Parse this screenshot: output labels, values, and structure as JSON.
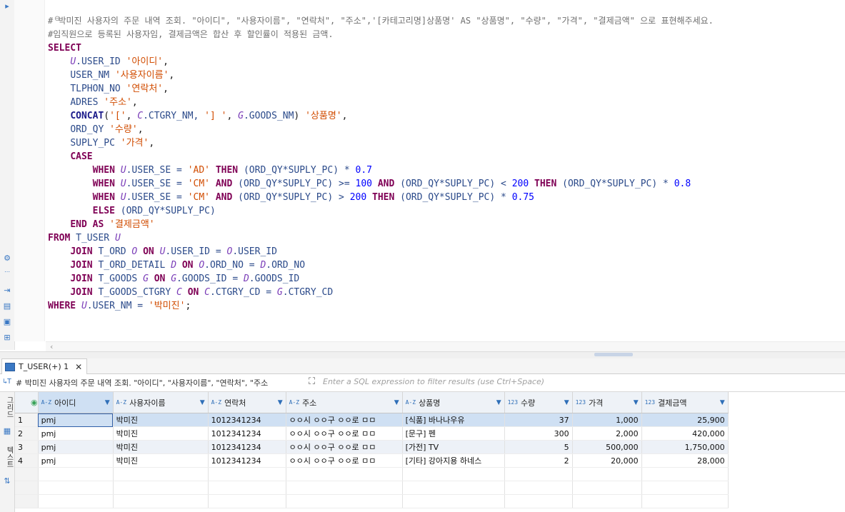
{
  "editor": {
    "lines": [
      [
        {
          "t": "# 박미진 사용자의 주문 내역 조회. \"아이디\", \"사용자이름\", \"연락처\", \"주소\",'[카테고리명]상품명' AS \"상품명\", \"수량\", \"가격\", \"결제금액\" 으로 표현해주세요.",
          "c": "cmt"
        }
      ],
      [
        {
          "t": "#임직원으로 등록된 사용자임, 결제금액은 합산 후 할인률이 적용된 금액.",
          "c": "cmt"
        }
      ],
      [
        {
          "t": "SELECT",
          "c": "kw"
        }
      ],
      [
        {
          "t": "    "
        },
        {
          "t": "U",
          "c": "al"
        },
        {
          "t": ".USER_ID ",
          "c": "idt"
        },
        {
          "t": "'아이디'",
          "c": "str2"
        },
        {
          "t": ","
        }
      ],
      [
        {
          "t": "    "
        },
        {
          "t": "USER_NM ",
          "c": "idt"
        },
        {
          "t": "'사용자이름'",
          "c": "str2"
        },
        {
          "t": ","
        }
      ],
      [
        {
          "t": "    "
        },
        {
          "t": "TLPHON_NO ",
          "c": "idt"
        },
        {
          "t": "'연락처'",
          "c": "str2"
        },
        {
          "t": ","
        }
      ],
      [
        {
          "t": "    "
        },
        {
          "t": "ADRES ",
          "c": "idt"
        },
        {
          "t": "'주소'",
          "c": "str2"
        },
        {
          "t": ","
        }
      ],
      [
        {
          "t": "    "
        },
        {
          "t": "CONCAT",
          "c": "fn"
        },
        {
          "t": "("
        },
        {
          "t": "'['",
          "c": "str2"
        },
        {
          "t": ", "
        },
        {
          "t": "C",
          "c": "al"
        },
        {
          "t": ".CTGRY_NM, ",
          "c": "idt"
        },
        {
          "t": "'] '",
          "c": "str2"
        },
        {
          "t": ", "
        },
        {
          "t": "G",
          "c": "al"
        },
        {
          "t": ".GOODS_NM",
          "c": "idt"
        },
        {
          "t": ") "
        },
        {
          "t": "'상품명'",
          "c": "str2"
        },
        {
          "t": ","
        }
      ],
      [
        {
          "t": "    "
        },
        {
          "t": "ORD_QY ",
          "c": "idt"
        },
        {
          "t": "'수량'",
          "c": "str2"
        },
        {
          "t": ","
        }
      ],
      [
        {
          "t": "    "
        },
        {
          "t": "SUPLY_PC ",
          "c": "idt"
        },
        {
          "t": "'가격'",
          "c": "str2"
        },
        {
          "t": ","
        }
      ],
      [
        {
          "t": "    "
        },
        {
          "t": "CASE",
          "c": "kw"
        }
      ],
      [
        {
          "t": "        "
        },
        {
          "t": "WHEN ",
          "c": "kw"
        },
        {
          "t": "U",
          "c": "al"
        },
        {
          "t": ".USER_SE = ",
          "c": "idt"
        },
        {
          "t": "'AD' ",
          "c": "str2"
        },
        {
          "t": "THEN ",
          "c": "kw"
        },
        {
          "t": "(ORD_QY*SUPLY_PC) * ",
          "c": "idt"
        },
        {
          "t": "0.7",
          "c": "num"
        }
      ],
      [
        {
          "t": "        "
        },
        {
          "t": "WHEN ",
          "c": "kw"
        },
        {
          "t": "U",
          "c": "al"
        },
        {
          "t": ".USER_SE = ",
          "c": "idt"
        },
        {
          "t": "'CM' ",
          "c": "str2"
        },
        {
          "t": "AND ",
          "c": "kw"
        },
        {
          "t": "(ORD_QY*SUPLY_PC) >= ",
          "c": "idt"
        },
        {
          "t": "100 ",
          "c": "num"
        },
        {
          "t": "AND ",
          "c": "kw"
        },
        {
          "t": "(ORD_QY*SUPLY_PC) < ",
          "c": "idt"
        },
        {
          "t": "200 ",
          "c": "num"
        },
        {
          "t": "THEN ",
          "c": "kw"
        },
        {
          "t": "(ORD_QY*SUPLY_PC) * ",
          "c": "idt"
        },
        {
          "t": "0.8",
          "c": "num"
        }
      ],
      [
        {
          "t": "        "
        },
        {
          "t": "WHEN ",
          "c": "kw"
        },
        {
          "t": "U",
          "c": "al"
        },
        {
          "t": ".USER_SE = ",
          "c": "idt"
        },
        {
          "t": "'CM' ",
          "c": "str2"
        },
        {
          "t": "AND ",
          "c": "kw"
        },
        {
          "t": "(ORD_QY*SUPLY_PC) > ",
          "c": "idt"
        },
        {
          "t": "200 ",
          "c": "num"
        },
        {
          "t": "THEN ",
          "c": "kw"
        },
        {
          "t": "(ORD_QY*SUPLY_PC) * ",
          "c": "idt"
        },
        {
          "t": "0.75",
          "c": "num"
        }
      ],
      [
        {
          "t": "        "
        },
        {
          "t": "ELSE ",
          "c": "kw"
        },
        {
          "t": "(ORD_QY*SUPLY_PC)",
          "c": "idt"
        }
      ],
      [
        {
          "t": "    "
        },
        {
          "t": "END AS ",
          "c": "kw"
        },
        {
          "t": "'결제금액'",
          "c": "str2"
        }
      ],
      [
        {
          "t": "FROM ",
          "c": "kw"
        },
        {
          "t": "T_USER ",
          "c": "idt"
        },
        {
          "t": "U",
          "c": "al"
        }
      ],
      [
        {
          "t": "    "
        },
        {
          "t": "JOIN ",
          "c": "kw"
        },
        {
          "t": "T_ORD ",
          "c": "idt"
        },
        {
          "t": "O ",
          "c": "al"
        },
        {
          "t": "ON ",
          "c": "kw"
        },
        {
          "t": "U",
          "c": "al"
        },
        {
          "t": ".USER_ID = ",
          "c": "idt"
        },
        {
          "t": "O",
          "c": "al"
        },
        {
          "t": ".USER_ID",
          "c": "idt"
        }
      ],
      [
        {
          "t": "    "
        },
        {
          "t": "JOIN ",
          "c": "kw"
        },
        {
          "t": "T_ORD_DETAIL ",
          "c": "idt"
        },
        {
          "t": "D ",
          "c": "al"
        },
        {
          "t": "ON ",
          "c": "kw"
        },
        {
          "t": "O",
          "c": "al"
        },
        {
          "t": ".ORD_NO = ",
          "c": "idt"
        },
        {
          "t": "D",
          "c": "al"
        },
        {
          "t": ".ORD_NO",
          "c": "idt"
        }
      ],
      [
        {
          "t": "    "
        },
        {
          "t": "JOIN ",
          "c": "kw"
        },
        {
          "t": "T_GOODS ",
          "c": "idt"
        },
        {
          "t": "G ",
          "c": "al"
        },
        {
          "t": "ON ",
          "c": "kw"
        },
        {
          "t": "G",
          "c": "al"
        },
        {
          "t": ".GOODS_ID = ",
          "c": "idt"
        },
        {
          "t": "D",
          "c": "al"
        },
        {
          "t": ".GOODS_ID",
          "c": "idt"
        }
      ],
      [
        {
          "t": "    "
        },
        {
          "t": "JOIN ",
          "c": "kw"
        },
        {
          "t": "T_GOODS_CTGRY ",
          "c": "idt"
        },
        {
          "t": "C ",
          "c": "al"
        },
        {
          "t": "ON ",
          "c": "kw"
        },
        {
          "t": "C",
          "c": "al"
        },
        {
          "t": ".CTGRY_CD = ",
          "c": "idt"
        },
        {
          "t": "G",
          "c": "al"
        },
        {
          "t": ".CTGRY_CD",
          "c": "idt"
        }
      ],
      [
        {
          "t": "WHERE ",
          "c": "kw"
        },
        {
          "t": "U",
          "c": "al"
        },
        {
          "t": ".USER_NM = ",
          "c": "idt"
        },
        {
          "t": "'박미진'",
          "c": "str2"
        },
        {
          "t": ";"
        }
      ]
    ]
  },
  "results": {
    "tab_label": "T_USER(+) 1",
    "tab_close": "✕",
    "filter_sql": "# 박미진 사용자의 주문 내역 조회. \"아이디\", \"사용자이름\", \"연락처\", \"주소",
    "filter_placeholder": "Enter a SQL expression to filter results (use Ctrl+Space)",
    "side_tabs": [
      "그리드",
      "텍스트"
    ],
    "columns": [
      {
        "label": "아이디",
        "type": "A-Z"
      },
      {
        "label": "사용자이름",
        "type": "A-Z"
      },
      {
        "label": "연락처",
        "type": "A-Z"
      },
      {
        "label": "주소",
        "type": "A-Z"
      },
      {
        "label": "상품명",
        "type": "A-Z"
      },
      {
        "label": "수량",
        "type": "123"
      },
      {
        "label": "가격",
        "type": "123"
      },
      {
        "label": "결제금액",
        "type": "123"
      }
    ],
    "rows": [
      {
        "n": "1",
        "cells": [
          "pmj",
          "박미진",
          "1012341234",
          "ㅇㅇ시 ㅇㅇ구 ㅇㅇ로 ㅁㅁ",
          "[식품] 바나나우유",
          "37",
          "1,000",
          "25,900"
        ]
      },
      {
        "n": "2",
        "cells": [
          "pmj",
          "박미진",
          "1012341234",
          "ㅇㅇ시 ㅇㅇ구 ㅇㅇ로 ㅁㅁ",
          "[문구] 펜",
          "300",
          "2,000",
          "420,000"
        ]
      },
      {
        "n": "3",
        "cells": [
          "pmj",
          "박미진",
          "1012341234",
          "ㅇㅇ시 ㅇㅇ구 ㅇㅇ로 ㅁㅁ",
          "[가전] TV",
          "5",
          "500,000",
          "1,750,000"
        ]
      },
      {
        "n": "4",
        "cells": [
          "pmj",
          "박미진",
          "1012341234",
          "ㅇㅇ시 ㅇㅇ구 ㅇㅇ로 ㅁㅁ",
          "[기타] 강아지용 하네스",
          "2",
          "20,000",
          "28,000"
        ]
      }
    ]
  },
  "colors": {
    "accent": "#3a78c4",
    "selected_row": "#cfe0f3",
    "keyword": "#7f0055",
    "string": "#d14c00",
    "number": "#0000ff"
  }
}
